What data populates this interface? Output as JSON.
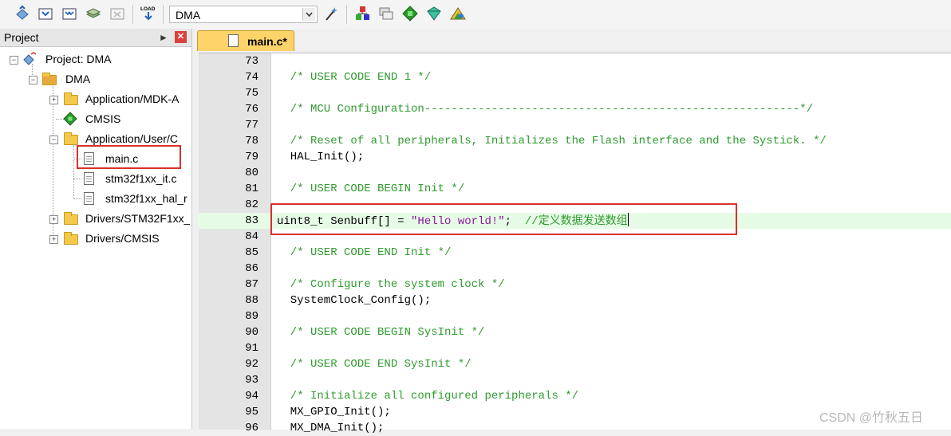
{
  "toolbar": {
    "target_value": "DMA",
    "load_label": "LOAD"
  },
  "project": {
    "title": "Project",
    "tree": [
      {
        "label": "Project: DMA"
      },
      {
        "label": "DMA"
      },
      {
        "label": "Application/MDK-A"
      },
      {
        "label": "CMSIS"
      },
      {
        "label": "Application/User/C"
      },
      {
        "label": "main.c"
      },
      {
        "label": "stm32f1xx_it.c"
      },
      {
        "label": "stm32f1xx_hal_r"
      },
      {
        "label": "Drivers/STM32F1xx_"
      },
      {
        "label": "Drivers/CMSIS"
      }
    ]
  },
  "editor": {
    "tab_label": "main.c*",
    "lines": [
      {
        "num": "73",
        "text": ""
      },
      {
        "num": "74",
        "text": "  /* USER CODE END 1 */"
      },
      {
        "num": "75",
        "text": ""
      },
      {
        "num": "76",
        "text": "  /* MCU Configuration--------------------------------------------------------*/"
      },
      {
        "num": "77",
        "text": ""
      },
      {
        "num": "78",
        "text": "  /* Reset of all peripherals, Initializes the Flash interface and the Systick. */"
      },
      {
        "num": "79",
        "text": "  HAL_Init();"
      },
      {
        "num": "80",
        "text": ""
      },
      {
        "num": "81",
        "text": "  /* USER CODE BEGIN Init */"
      },
      {
        "num": "82",
        "text": ""
      },
      {
        "num": "83",
        "code": "uint8_t Senbuff[] = ",
        "string": "\"Hello world!\"",
        "rest": ";  ",
        "comment": "//定义数据发送数组"
      },
      {
        "num": "84",
        "text": ""
      },
      {
        "num": "85",
        "text": "  /* USER CODE END Init */"
      },
      {
        "num": "86",
        "text": ""
      },
      {
        "num": "87",
        "text": "  /* Configure the system clock */"
      },
      {
        "num": "88",
        "text": "  SystemClock_Config();"
      },
      {
        "num": "89",
        "text": ""
      },
      {
        "num": "90",
        "text": "  /* USER CODE BEGIN SysInit */"
      },
      {
        "num": "91",
        "text": ""
      },
      {
        "num": "92",
        "text": "  /* USER CODE END SysInit */"
      },
      {
        "num": "93",
        "text": ""
      },
      {
        "num": "94",
        "text": "  /* Initialize all configured peripherals */"
      },
      {
        "num": "95",
        "text": "  MX_GPIO_Init();"
      },
      {
        "num": "96",
        "text": "  MX_DMA_Init();"
      }
    ]
  },
  "watermark": "CSDN @竹秋五日"
}
